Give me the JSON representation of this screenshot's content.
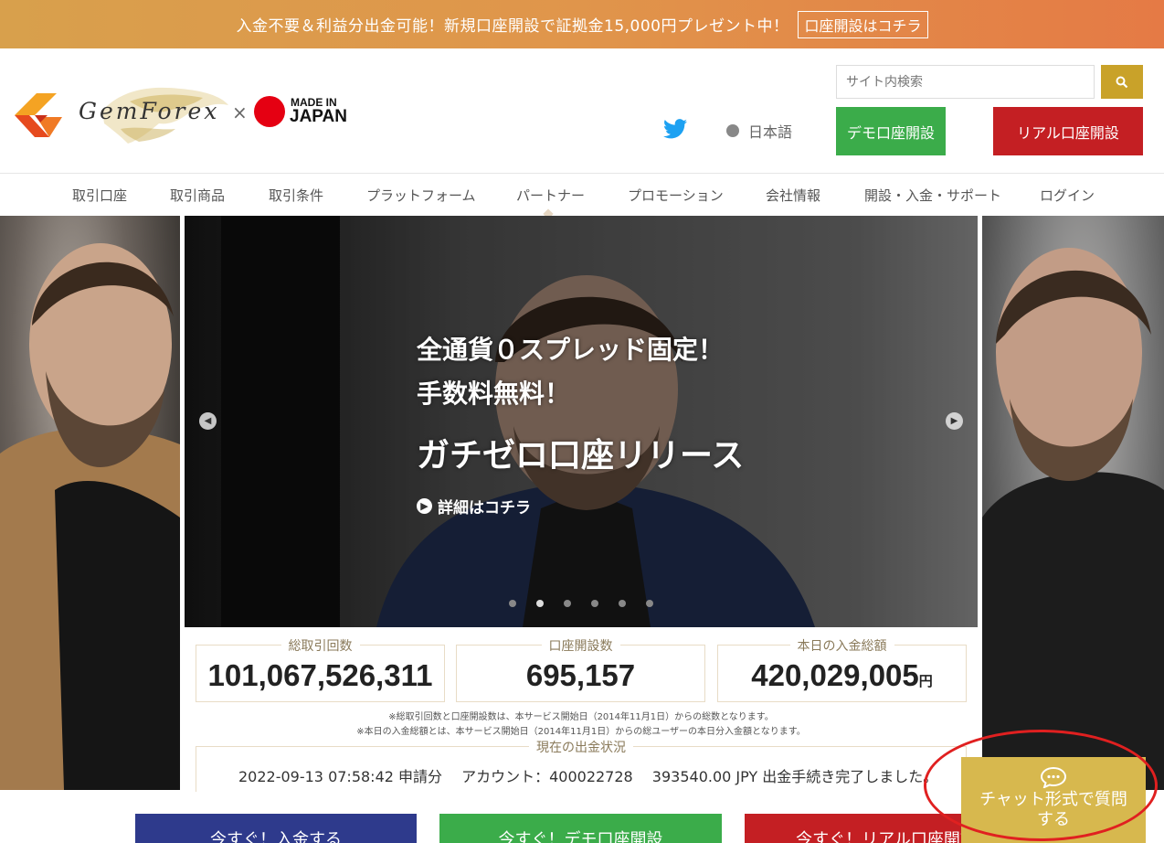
{
  "promo": {
    "text": "入金不要＆利益分出金可能！新規口座開設で証拠金15,000円プレゼント中！",
    "button": "口座開設はコチラ"
  },
  "header": {
    "logo_name": "GemForex",
    "logo_x": "×",
    "made_in": "MADE IN",
    "japan": "JAPAN",
    "search_placeholder": "サイト内検索",
    "language": "日本語",
    "demo_button": "デモ口座開設",
    "real_button": "リアル口座開設"
  },
  "nav": {
    "items": [
      "取引口座",
      "取引商品",
      "取引条件",
      "プラットフォーム",
      "パートナー",
      "プロモーション",
      "会社情報",
      "開設・入金・サポート",
      "ログイン"
    ]
  },
  "slider": {
    "headline1": "全通貨０スプレッド固定！",
    "headline2": "手数料無料！",
    "headline3": "ガチゼロ口座リリース",
    "link": "詳細はコチラ",
    "dots": 6,
    "active_dot": 2
  },
  "stats": {
    "total_trades_label": "総取引回数",
    "total_trades_value": "101,067,526,311",
    "accounts_label": "口座開設数",
    "accounts_value": "695,157",
    "deposits_label": "本日の入金総額",
    "deposits_value": "420,029,005",
    "deposits_unit": "円",
    "note1": "※総取引回数と口座開設数は、本サービス開始日（2014年11月1日）からの総数となります。",
    "note2": "※本日の入金総額とは、本サービス開始日（2014年11月1日）からの総ユーザーの本日分入金額となります。"
  },
  "withdrawal": {
    "label": "現在の出金状況",
    "text": "2022-09-13 07:58:42 申請分　 アカウント：400022728　 393540.00 JPY 出金手続き完了しました。"
  },
  "bottom": {
    "deposit": "今すぐ！入金する",
    "demo": "今すぐ！デモ口座開設",
    "real": "今すぐ！リアル口座開設"
  },
  "chat": {
    "line1": "チャット形式で質問",
    "line2": "する"
  },
  "colors": {
    "gold": "#c9a229",
    "green": "#3bac4a",
    "red": "#c41f23",
    "navy": "#2e3a8c"
  }
}
